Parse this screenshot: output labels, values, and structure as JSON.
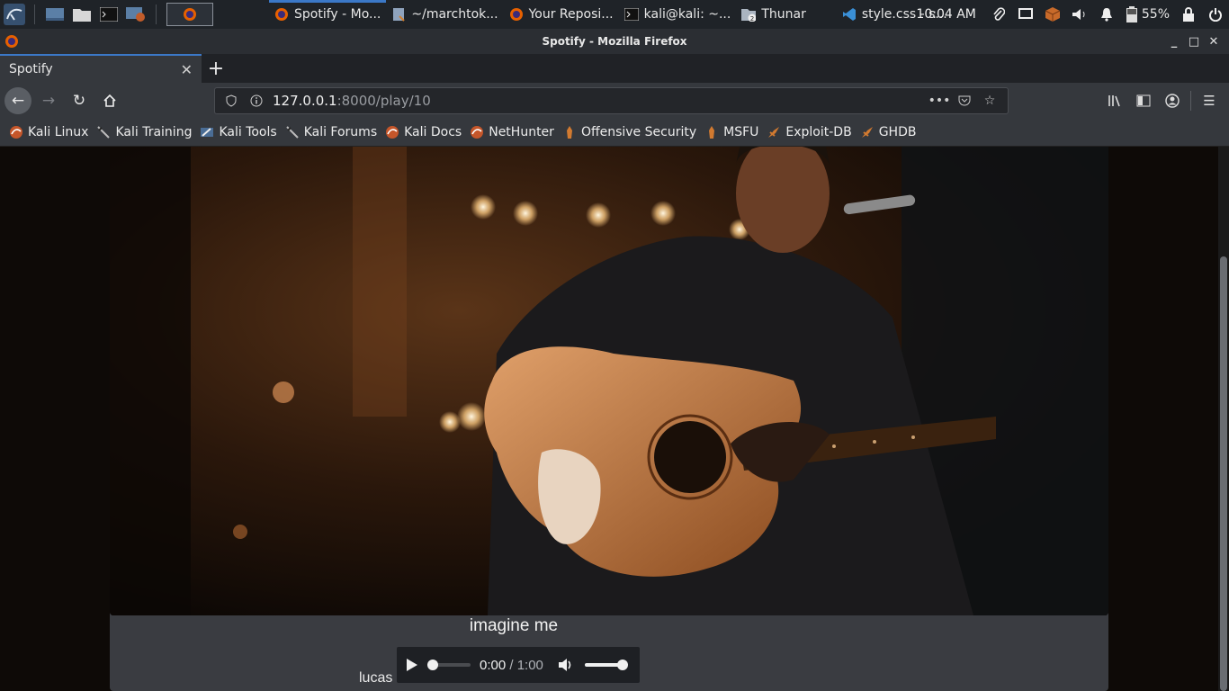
{
  "taskbar": {
    "tasks": [
      {
        "label": "Spotify - Mo...",
        "icon": "firefox-icon",
        "active": true
      },
      {
        "label": "~/marchtok...",
        "icon": "file-editor-icon",
        "active": false
      },
      {
        "label": "Your Reposi...",
        "icon": "firefox-icon",
        "active": false
      },
      {
        "label": "kali@kali: ~...",
        "icon": "terminal-icon",
        "active": false
      },
      {
        "label": "Thunar",
        "icon": "folder-icon",
        "active": false,
        "badge": "2"
      },
      {
        "label": "style.css - s...",
        "icon": "vscode-icon",
        "active": false
      }
    ],
    "clock": "10:04 AM",
    "battery": "55%"
  },
  "window": {
    "title": "Spotify - Mozilla Firefox"
  },
  "browser": {
    "tab_title": "Spotify",
    "url_host": "127.0.0.1",
    "url_path": ":8000/play/10",
    "bookmarks": [
      {
        "label": "Kali Linux",
        "icon": "kali-dragon-icon"
      },
      {
        "label": "Kali Training",
        "icon": "kali-sword-icon"
      },
      {
        "label": "Kali Tools",
        "icon": "kali-tools-icon"
      },
      {
        "label": "Kali Forums",
        "icon": "kali-sword-icon"
      },
      {
        "label": "Kali Docs",
        "icon": "kali-dragon-icon"
      },
      {
        "label": "NetHunter",
        "icon": "kali-dragon-icon"
      },
      {
        "label": "Offensive Security",
        "icon": "offsec-icon"
      },
      {
        "label": "MSFU",
        "icon": "offsec-icon"
      },
      {
        "label": "Exploit-DB",
        "icon": "exploitdb-icon"
      },
      {
        "label": "GHDB",
        "icon": "exploitdb-icon"
      }
    ]
  },
  "player": {
    "song_title": "imagine me",
    "artist": "lucas",
    "current_time": "0:00",
    "duration": "/ 1:00",
    "progress": 0,
    "volume": 1.0
  },
  "colors": {
    "accent": "#3b78c7",
    "page_bg": "#0e0a07",
    "card_bg": "#3a3c41"
  }
}
